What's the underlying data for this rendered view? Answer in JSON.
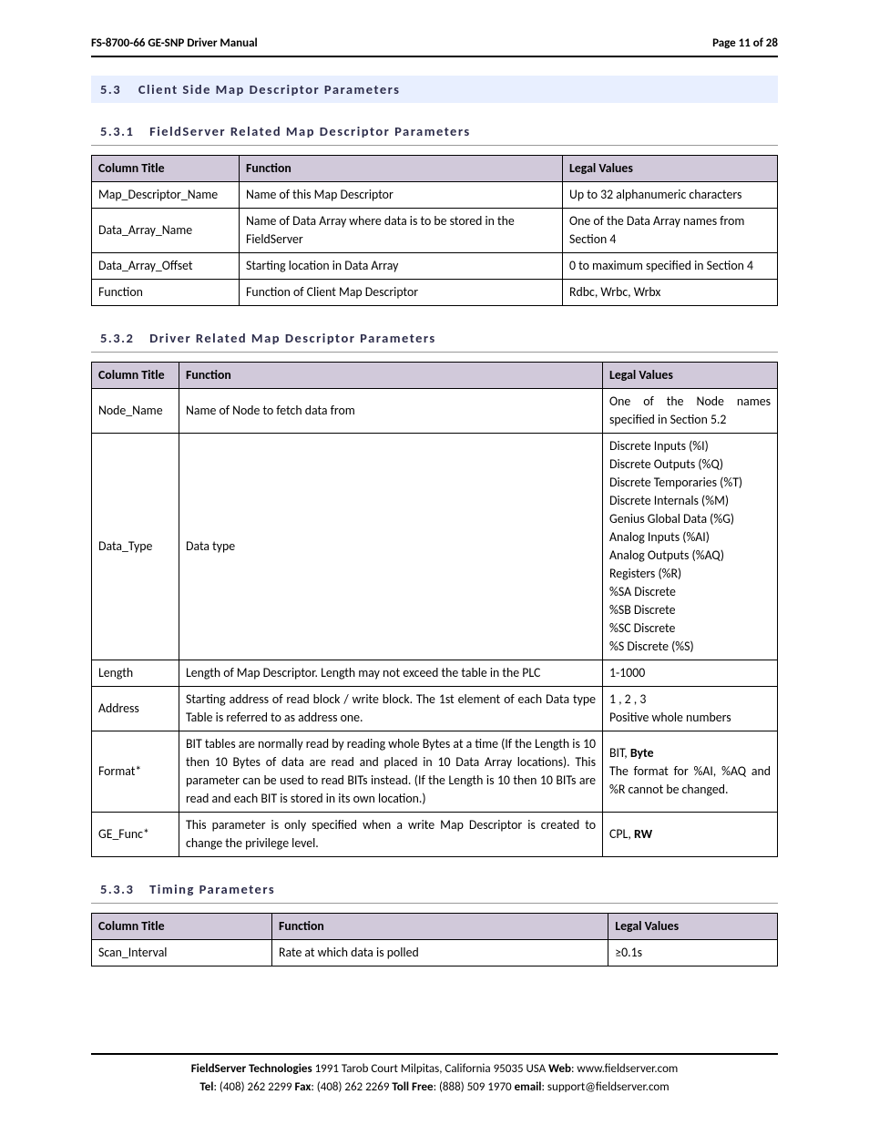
{
  "header": {
    "left": "FS-8700-66 GE-SNP Driver Manual",
    "right": "Page 11 of 28"
  },
  "s53": {
    "num": "5.3",
    "title": "Client Side Map Descriptor Parameters"
  },
  "s531": {
    "num": "5.3.1",
    "title": "FieldServer Related Map Descriptor Parameters",
    "h": {
      "c1": "Column Title",
      "c2": "Function",
      "c3": "Legal Values"
    },
    "r1": {
      "c1": "Map_Descriptor_Name",
      "c2": "Name of this Map Descriptor",
      "c3": "Up to 32 alphanumeric characters"
    },
    "r2": {
      "c1": "Data_Array_Name",
      "c2": "Name of Data Array where data is to be stored in the FieldServer",
      "c3": "One of the Data Array names from Section 4"
    },
    "r3": {
      "c1": "Data_Array_Offset",
      "c2": "Starting location in Data Array",
      "c3": "0 to maximum specified in Section 4"
    },
    "r4": {
      "c1": "Function",
      "c2": "Function of Client Map Descriptor",
      "c3": "Rdbc, Wrbc, Wrbx"
    }
  },
  "s532": {
    "num": "5.3.2",
    "title": "Driver Related Map Descriptor Parameters",
    "h": {
      "c1": "Column Title",
      "c2": "Function",
      "c3": "Legal Values"
    },
    "r1": {
      "c1": "Node_Name",
      "c2": "Name of Node to fetch data from",
      "c3": "One of the Node names specified in Section 5.2"
    },
    "r2": {
      "c1": "Data_Type",
      "c2": "Data type",
      "l0": "Discrete Inputs (%I)",
      "l1": "Discrete Outputs (%Q)",
      "l2": "Discrete Temporaries (%T)",
      "l3": "Discrete Internals (%M)",
      "l4": "Genius Global Data (%G)",
      "l5": "Analog Inputs (%AI)",
      "l6": "Analog Outputs (%AQ)",
      "l7": "Registers (%R)",
      "l8": "%SA Discrete",
      "l9": "%SB Discrete",
      "l10": "%SC Discrete",
      "l11": "%S Discrete (%S)"
    },
    "r3": {
      "c1": "Length",
      "c2": "Length of Map Descriptor.  Length may not exceed the table in the PLC",
      "c3": "1-1000"
    },
    "r4": {
      "c1": "Address",
      "c2": "Starting address of read block / write block.  The 1st element of each Data type Table is referred to as address one.",
      "l0": "1 , 2 , 3",
      "l1": "Positive whole numbers"
    },
    "r5": {
      "c1": "Format*",
      "c2": "BIT tables are normally read by reading whole Bytes at a time (If the Length is 10 then 10 Bytes of data are read and placed in 10 Data Array locations).  This parameter can be used to read BITs instead.  (If the Length is 10 then 10 BITs are read and each BIT is stored in its own location.)",
      "l0a": "BIT, ",
      "l0b": "Byte",
      "l1": "The format for %AI, %AQ and %R cannot be changed."
    },
    "r6": {
      "c1": "GE_Func*",
      "c2": "This parameter is only specified when a write Map Descriptor is created to change the privilege level.",
      "l0a": "CPL, ",
      "l0b": "RW"
    }
  },
  "s533": {
    "num": "5.3.3",
    "title": "Timing Parameters",
    "h": {
      "c1": "Column Title",
      "c2": "Function",
      "c3": "Legal Values"
    },
    "r1": {
      "c1": "Scan_Interval",
      "c2": "Rate at which data is polled",
      "c3": "≥0.1s"
    }
  },
  "footer": {
    "l1a": "FieldServer Technologies",
    "l1b": " 1991 Tarob Court Milpitas, California 95035 USA   ",
    "l1c": "Web",
    "l1d": ": www.fieldserver.com",
    "l2a": "Tel",
    "l2b": ": (408) 262 2299   ",
    "l2c": "Fax",
    "l2d": ": (408) 262 2269   ",
    "l2e": "Toll Free",
    "l2f": ": (888) 509 1970   ",
    "l2g": "email",
    "l2h": ": support@fieldserver.com"
  }
}
